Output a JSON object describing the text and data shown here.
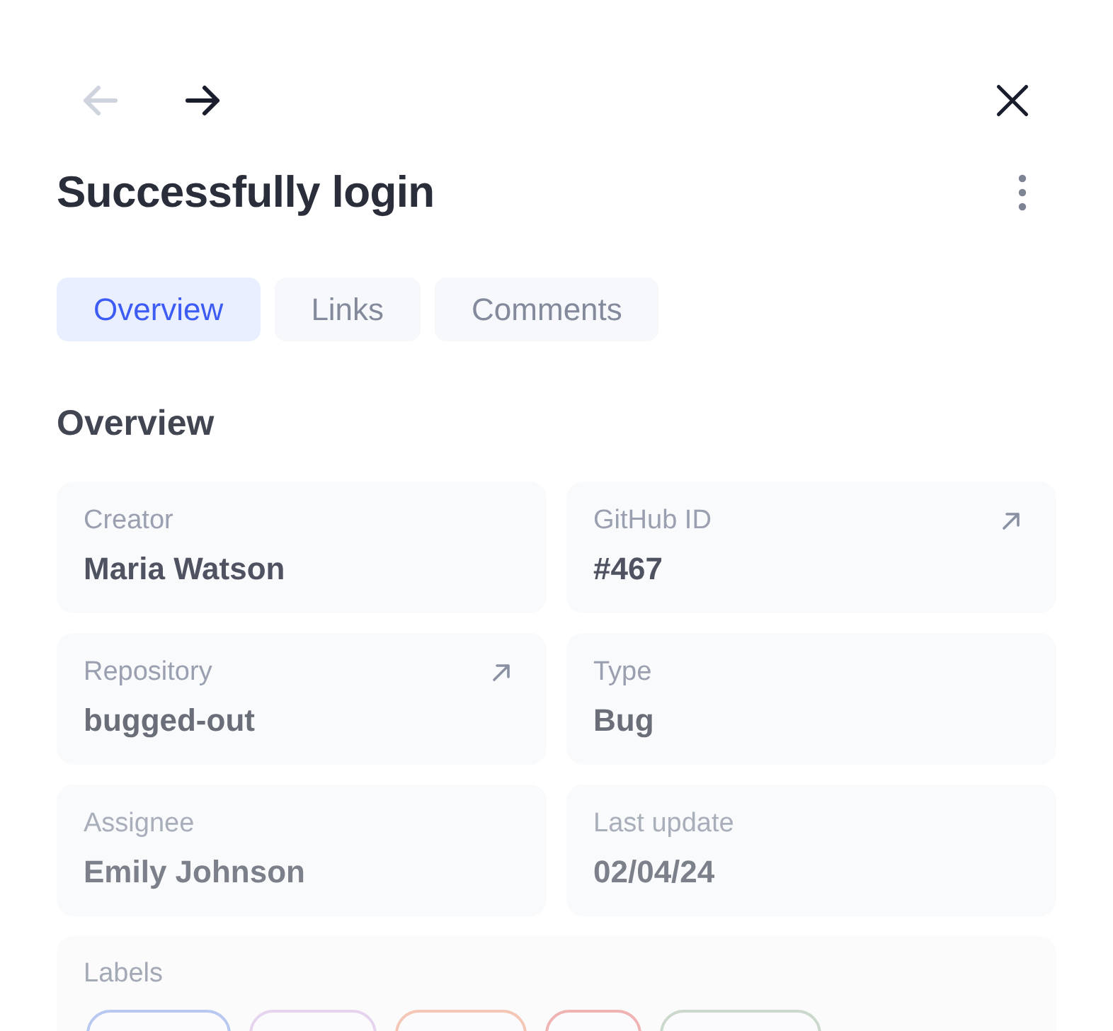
{
  "navigation": {
    "back": {
      "disabled": true
    },
    "forward": {
      "disabled": false
    }
  },
  "title": "Successfully login",
  "tabs": [
    {
      "label": "Overview",
      "selected": true
    },
    {
      "label": "Links",
      "selected": false
    },
    {
      "label": "Comments",
      "selected": false
    }
  ],
  "section_title": "Overview",
  "fields": [
    {
      "label": "Creator",
      "value": "Maria Watson",
      "link": false
    },
    {
      "label": "GitHub ID",
      "value": "#467",
      "link": true
    },
    {
      "label": "Repository",
      "value": "bugged-out",
      "link": true
    },
    {
      "label": "Type",
      "value": "Bug",
      "link": false
    },
    {
      "label": "Assignee",
      "value": "Emily Johnson",
      "link": false
    },
    {
      "label": "Last update",
      "value": "02/04/24",
      "link": false
    }
  ],
  "labels": {
    "title": "Labels",
    "tags": [
      {
        "color": "#b8c8f0"
      },
      {
        "color": "#e6d3ee"
      },
      {
        "color": "#f3c6b5"
      },
      {
        "color": "#efb3b3"
      },
      {
        "color": "#cbd8cc"
      }
    ]
  }
}
